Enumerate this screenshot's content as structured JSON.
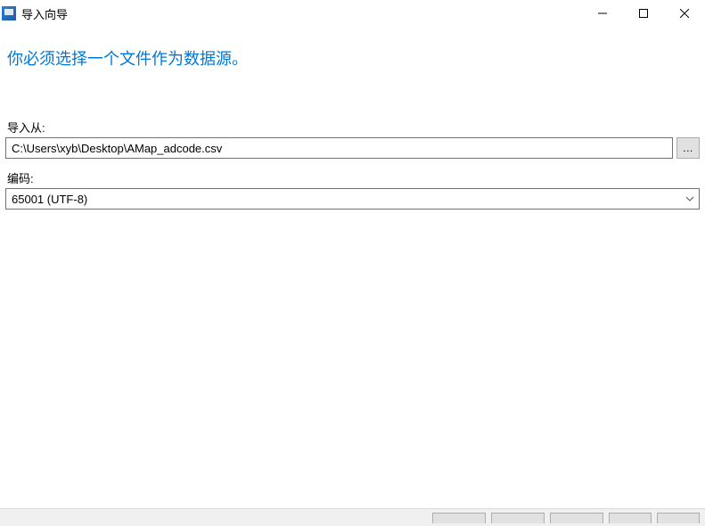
{
  "window": {
    "title": "导入向导"
  },
  "heading": "你必须选择一个文件作为数据源。",
  "fields": {
    "importFrom": {
      "label": "导入从:",
      "value": "C:\\Users\\xyb\\Desktop\\AMap_adcode.csv",
      "browseLabel": "..."
    },
    "encoding": {
      "label": "编码:",
      "value": "65001 (UTF-8)"
    }
  }
}
